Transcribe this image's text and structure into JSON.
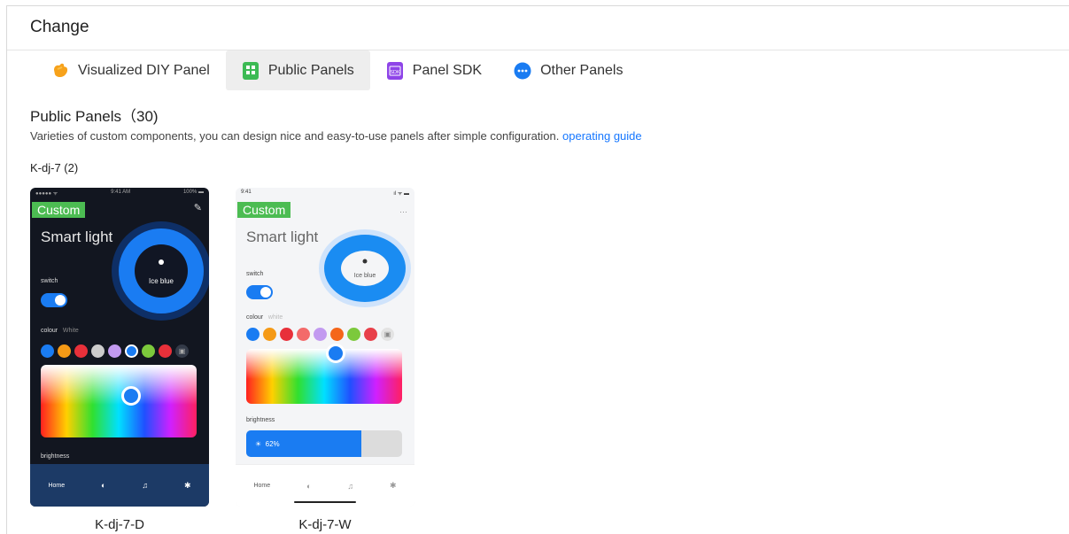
{
  "header": {
    "title": "Change"
  },
  "tabs": [
    {
      "label": "Visualized DIY Panel",
      "icon": "hand-icon",
      "color": "#f7a21b"
    },
    {
      "label": "Public Panels",
      "icon": "grid-icon",
      "color": "#3cba54",
      "active": true
    },
    {
      "label": "Panel SDK",
      "icon": "sdk-icon",
      "color": "#8e44e8",
      "icon_text": "SDK"
    },
    {
      "label": "Other Panels",
      "icon": "more-icon",
      "color": "#1a7cf2"
    }
  ],
  "section": {
    "title": "Public Panels（30)",
    "description": "Varieties of custom components, you can design nice and easy-to-use panels after simple configuration.",
    "link": "operating guide"
  },
  "group": {
    "label": "K-dj-7 (2)"
  },
  "cards": [
    {
      "caption": "K-dj-7-D",
      "badge": "Custom",
      "time": "9:41 AM",
      "carrier": "●●●●● ᯤ",
      "battery": "100% ▬",
      "title": "Smart light",
      "color_name": "Ice blue",
      "switch_label": "switch",
      "colour_label": "colour",
      "white_label": "White",
      "brightness_label": "brightness",
      "tab_home": "Home",
      "edit_icon": "edit-icon",
      "swatches": [
        "#1a7cf2",
        "#f59a16",
        "#e8303a",
        "#cccccc",
        "#c29af0",
        "#1a7cf2",
        "#7cc93c",
        "#e8303a"
      ]
    },
    {
      "caption": "K-dj-7-W",
      "badge": "Custom",
      "time": "9:41",
      "signal": "ıl ᯤ ▬",
      "more_icon": "···",
      "title": "Smart light",
      "color_name": "Ice blue",
      "switch_label": "switch",
      "colour_label": "colour",
      "white_label": "white",
      "brightness_label": "brightness",
      "brightness_value": "62%",
      "brightness_level": 0.62,
      "tab_home": "Home",
      "swatches": [
        "#1a7cf2",
        "#f59a16",
        "#e8303a",
        "#f36a6a",
        "#c29af0",
        "#f5661a",
        "#7cc93c",
        "#e8404a"
      ]
    }
  ]
}
